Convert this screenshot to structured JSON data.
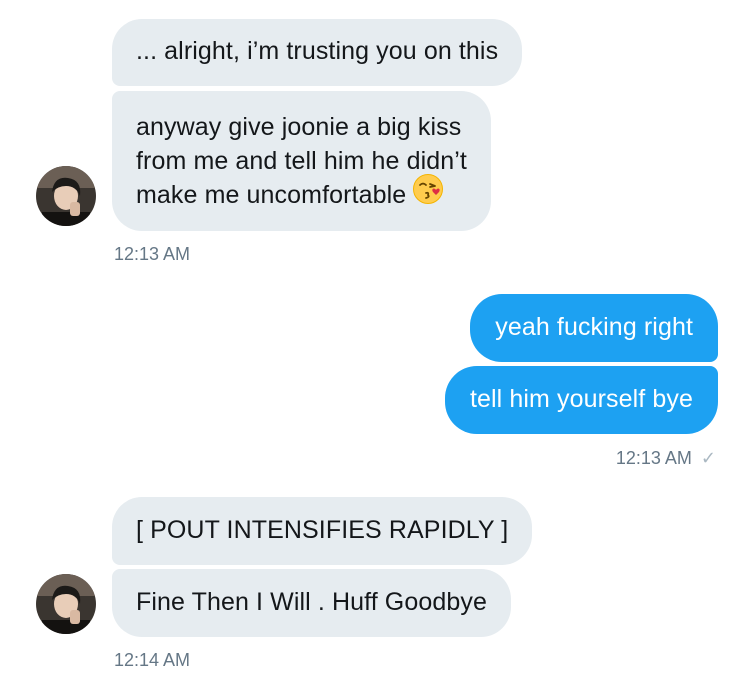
{
  "thread": {
    "group1": {
      "messages": [
        {
          "text": "... alright, i’m trusting you on this"
        },
        {
          "lines": [
            "anyway give joonie a big kiss",
            "from me and tell him he didn’t",
            "make me uncomfortable"
          ],
          "emoji": "kissing-face-icon"
        }
      ],
      "timestamp": "12:13 AM"
    },
    "group2": {
      "messages": [
        {
          "text": "yeah fucking right"
        },
        {
          "text": "tell him yourself bye"
        }
      ],
      "timestamp": "12:13 AM",
      "read_mark": "✓"
    },
    "group3": {
      "messages": [
        {
          "text": "[ POUT INTENSIFIES RAPIDLY ]"
        },
        {
          "text": "Fine Then I Will . Huff Goodbye"
        }
      ],
      "timestamp": "12:14 AM"
    }
  },
  "colors": {
    "incoming_bg": "#e6ecf0",
    "outgoing_bg": "#1da1f2",
    "timestamp": "#657786"
  }
}
